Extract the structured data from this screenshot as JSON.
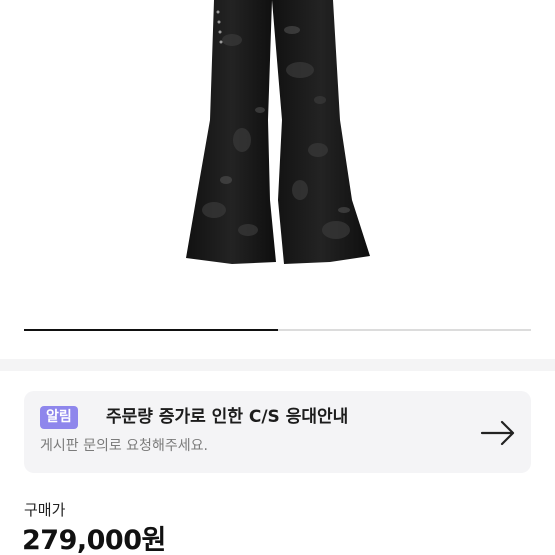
{
  "product": {
    "image_alt": "flared distressed black jeans",
    "carousel_progress": 0.5
  },
  "notice": {
    "badge": "알림",
    "title": "주문량 증가로 인한 C/S 응대안내",
    "subtitle": "게시판 문의로 요청해주세요.",
    "icon": "arrow-right-icon"
  },
  "price": {
    "label": "구매가",
    "value": "279,000원"
  }
}
